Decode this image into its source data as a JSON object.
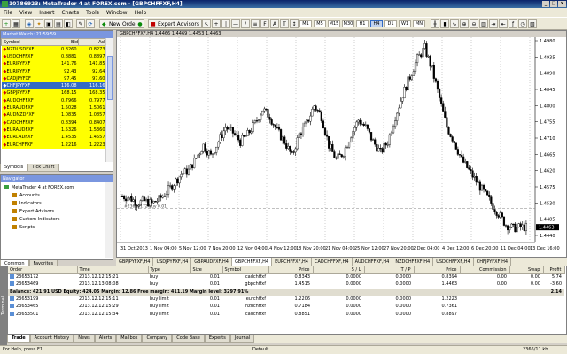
{
  "window": {
    "title": "10786923: MetaTrader 4 at FOREX.com - [GBPCHFFXF,H4]"
  },
  "menu": [
    "File",
    "View",
    "Insert",
    "Charts",
    "Tools",
    "Window",
    "Help"
  ],
  "toolbar": {
    "new_order": "New Order",
    "expert_advisors": "Expert Advisors",
    "timeframes": [
      "M1",
      "M5",
      "M15",
      "M30",
      "H1",
      "H4",
      "D1",
      "W1",
      "MN"
    ],
    "active_timeframe": "H4"
  },
  "market_watch": {
    "header": "Market Watch: 21:59:59",
    "columns": [
      "Symbol",
      "Bid",
      "Ask"
    ],
    "rows": [
      {
        "symbol": "NZDUSDFXF",
        "bid": "0.8260",
        "ask": "0.8273"
      },
      {
        "symbol": "USDCHFFXF",
        "bid": "0.8881",
        "ask": "0.8897"
      },
      {
        "symbol": "EURJPYFXF",
        "bid": "141.76",
        "ask": "141.85"
      },
      {
        "symbol": "EURJPYFXF",
        "bid": "92.43",
        "ask": "92.64"
      },
      {
        "symbol": "CADJPYFXF",
        "bid": "97.45",
        "ask": "97.60"
      },
      {
        "symbol": "CHFJPYFXF",
        "bid": "116.08",
        "ask": "116.16",
        "selected": true
      },
      {
        "symbol": "GBPJPYFXF",
        "bid": "168.15",
        "ask": "168.35"
      },
      {
        "symbol": "AUDCHFFXF",
        "bid": "0.7966",
        "ask": "0.7977"
      },
      {
        "symbol": "EURAUDFXF",
        "bid": "1.5028",
        "ask": "1.5061"
      },
      {
        "symbol": "AUDNZDFXF",
        "bid": "1.0835",
        "ask": "1.0857"
      },
      {
        "symbol": "CADCHFFXF",
        "bid": "0.8394",
        "ask": "0.8407"
      },
      {
        "symbol": "EURAUDFXF",
        "bid": "1.5326",
        "ask": "1.5360"
      },
      {
        "symbol": "EURCADFXF",
        "bid": "1.4535",
        "ask": "1.4557"
      },
      {
        "symbol": "EURCHFFXF",
        "bid": "1.2216",
        "ask": "1.2223"
      }
    ],
    "tabs": [
      "Symbols",
      "Tick Chart"
    ]
  },
  "navigator": {
    "header": "Navigator",
    "root": "MetaTrader 4 at FOREX.com",
    "items": [
      "Accounts",
      "Indicators",
      "Expert Advisors",
      "Custom Indicators",
      "Scripts"
    ],
    "tabs": [
      "Common",
      "Favorites"
    ]
  },
  "chart": {
    "header": "GBPCHFFXF,H4  1.4466 1.4469 1.4453 1.4463",
    "price_labels": [
      "1.4980",
      "1.4935",
      "1.4890",
      "1.4845",
      "1.4800",
      "1.4755",
      "1.4710",
      "1.4665",
      "1.4620",
      "1.4575",
      "1.4530",
      "1.4485",
      "1.4440"
    ],
    "date_labels": [
      "31 Oct 2013",
      "1 Nov 04:00",
      "5 Nov 12:00",
      "7 Nov 20:00",
      "12 Nov 04:00",
      "14 Nov 12:00",
      "18 Nov 20:00",
      "21 Nov 04:00",
      "25 Nov 12:00",
      "27 Nov 20:00",
      "2 Dec 04:00",
      "4 Dec 12:00",
      "6 Dec 20:00",
      "11 Dec 04:00",
      "13 Dec 16:00"
    ],
    "current_price": "1.4463",
    "trade_label": "#23653172 buy 0.01"
  },
  "chart_tabs": [
    "GBPJPYFXF,H4",
    "USDJPYFXF,H4",
    "GBPAUDFXF,H4",
    "GBPCHFFXF,H4",
    "EURCHFFXF,H4",
    "CADCHFFXF,H4",
    "AUDCHFFXF,H4",
    "NZDCHFFXF,H4",
    "USDCHFFXF,H4",
    "CHFJPYFXF,H4"
  ],
  "active_chart_tab": "GBPCHFFXF,H4",
  "terminal": {
    "side_label": "Terminal",
    "columns": [
      "Order",
      "Time",
      "Type",
      "Size",
      "Symbol",
      "Price",
      "S / L",
      "T / P",
      "Price",
      "Commission",
      "Swap",
      "Profit"
    ],
    "open_orders": [
      {
        "order": "23653172",
        "time": "2013.12.12 15:21",
        "type": "buy",
        "size": "0.01",
        "symbol": "cadchffxf",
        "price": "0.8343",
        "sl": "0.0000",
        "tp": "0.0000",
        "cur_price": "0.8394",
        "commission": "0.00",
        "swap": "0.00",
        "profit": "5.74"
      },
      {
        "order": "23653469",
        "time": "2013.12.13 08:08",
        "type": "buy",
        "size": "0.01",
        "symbol": "gbpchffxf",
        "price": "1.4515",
        "sl": "0.0000",
        "tp": "0.0000",
        "cur_price": "1.4463",
        "commission": "0.00",
        "swap": "0.00",
        "profit": "-3.60"
      }
    ],
    "balance_line": "Balance: 421.91 USD  Equity: 424.05  Margin: 12.86  Free margin: 411.19  Margin level: 3297.91%",
    "balance_profit": "2.14",
    "pending_orders": [
      {
        "order": "23653199",
        "time": "2013.12.12 15:11",
        "type": "buy limit",
        "size": "0.01",
        "symbol": "eurchffxf",
        "price": "1.2206",
        "sl": "0.0000",
        "tp": "0.0000",
        "cur_price": "1.2223",
        "commission": "",
        "swap": "",
        "profit": ""
      },
      {
        "order": "23653465",
        "time": "2013.12.12 15:29",
        "type": "buy limit",
        "size": "0.01",
        "symbol": "nzdchffxf",
        "price": "0.7184",
        "sl": "0.0000",
        "tp": "0.0000",
        "cur_price": "0.7361",
        "commission": "",
        "swap": "",
        "profit": ""
      },
      {
        "order": "23653501",
        "time": "2013.12.12 15:34",
        "type": "buy limit",
        "size": "0.01",
        "symbol": "cadchffxf",
        "price": "0.8851",
        "sl": "0.0000",
        "tp": "0.0000",
        "cur_price": "0.8897",
        "commission": "",
        "swap": "",
        "profit": ""
      }
    ],
    "tabs": [
      "Trade",
      "Account History",
      "News",
      "Alerts",
      "Mailbox",
      "Company",
      "Code Base",
      "Experts",
      "Journal"
    ]
  },
  "status": {
    "help": "For Help, press F1",
    "profile": "Default",
    "traffic": "2366/11 kb"
  },
  "colors": {
    "market_watch_row": "#ffff00",
    "selection": "#316ac5",
    "candle": "#000000"
  }
}
